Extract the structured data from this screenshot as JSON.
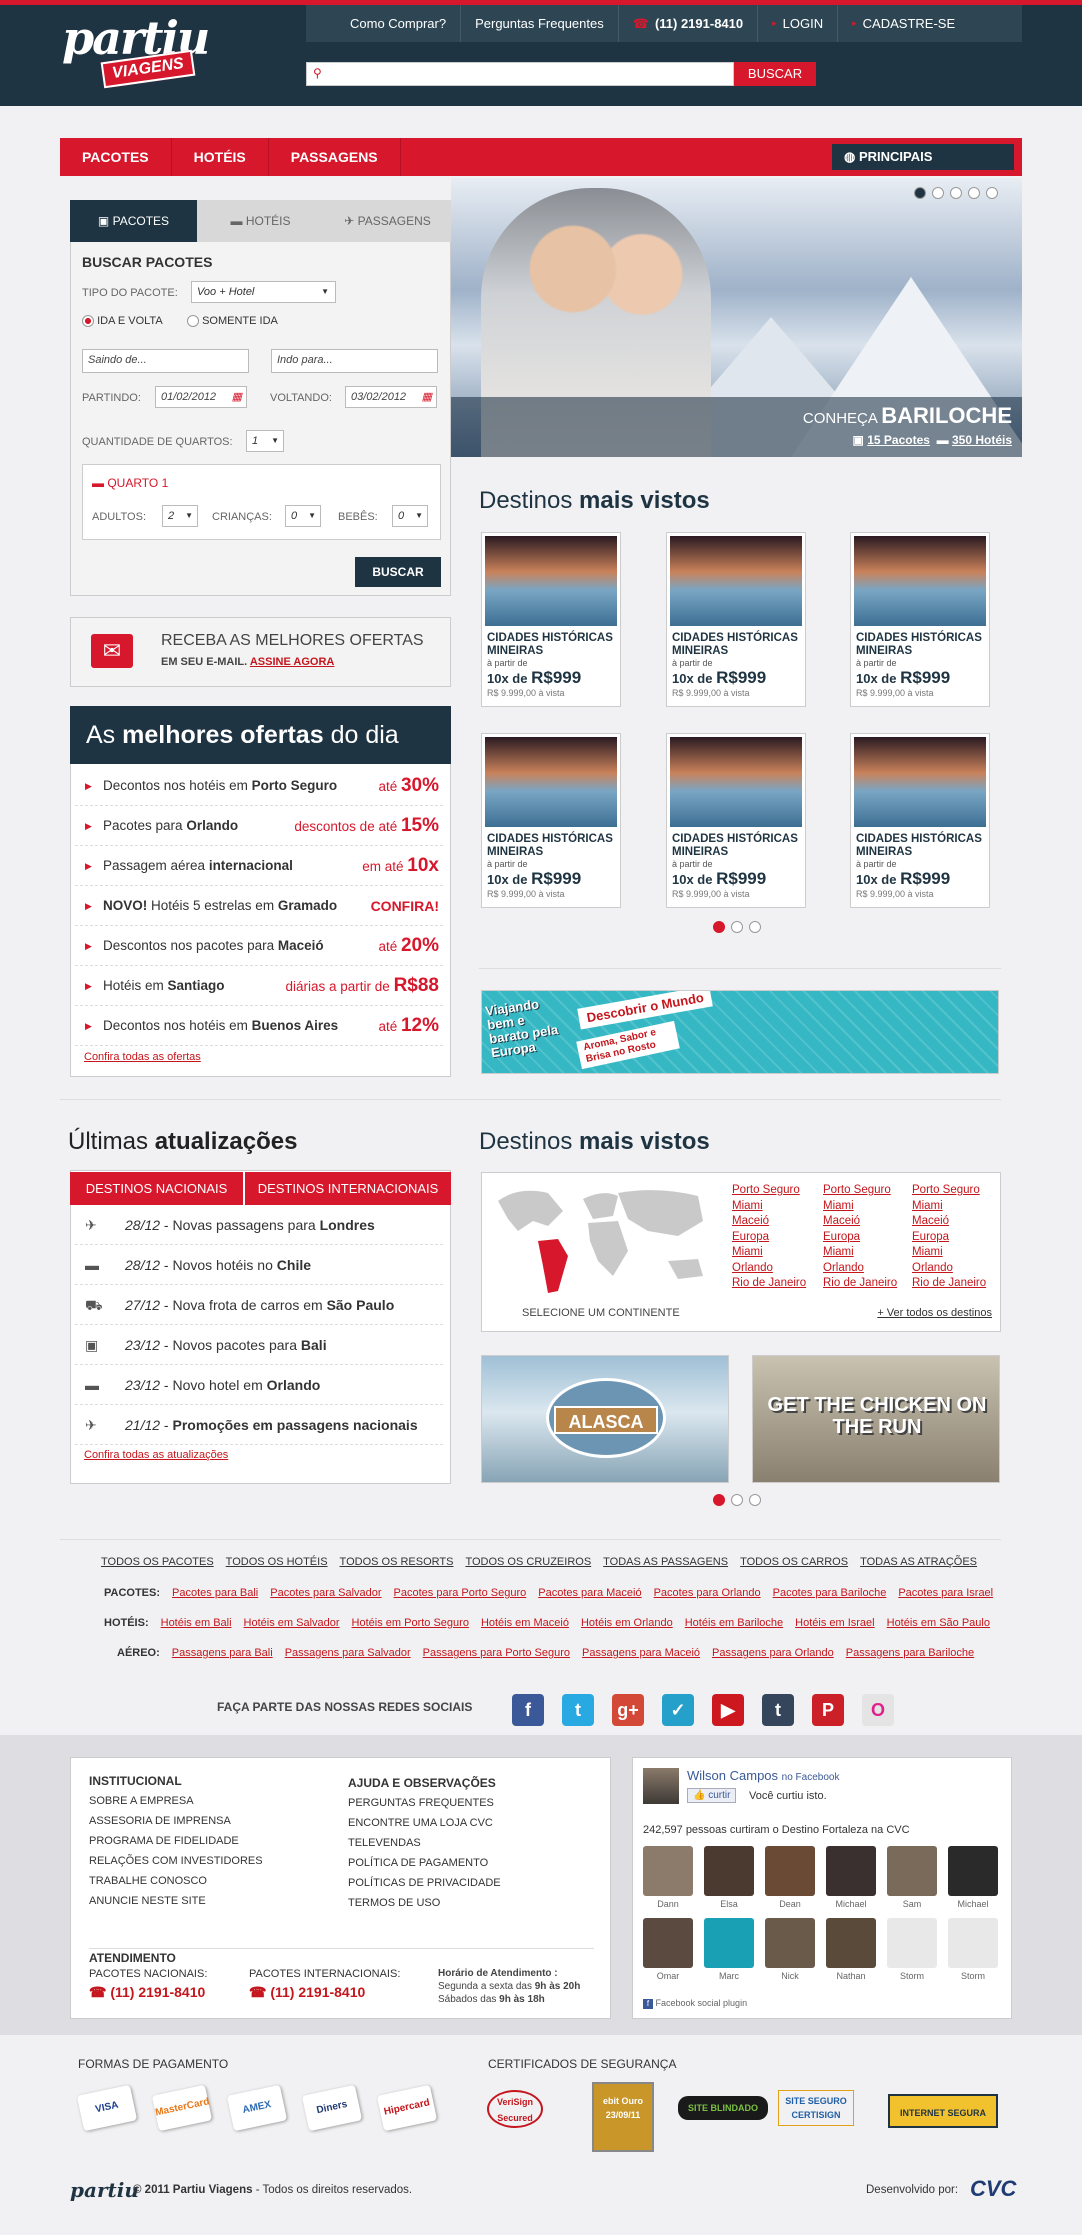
{
  "brand": {
    "logo_main": "partiu",
    "logo_sub": "VIAGENS"
  },
  "header": {
    "links": [
      "Como Comprar?",
      "Perguntas Frequentes"
    ],
    "phone": "(11) 2191-8410",
    "login": "LOGIN",
    "signup": "CADASTRE-SE",
    "search_placeholder": "",
    "search_button": "BUSCAR"
  },
  "nav": {
    "items": [
      "PACOTES",
      "HOTÉIS",
      "PASSAGENS"
    ],
    "dest_button": "PRINCIPAIS DESTINOS"
  },
  "hero": {
    "title_pre": "CONHEÇA",
    "title": "BARILOCHE",
    "pacotes": "15 Pacotes",
    "hoteis": "350 Hotéis",
    "slides": 5,
    "active_slide": 1
  },
  "search_panel": {
    "tabs": [
      "PACOTES",
      "HOTÉIS",
      "PASSAGENS"
    ],
    "title": "BUSCAR PACOTES",
    "tipo_label": "TIPO DO PACOTE:",
    "tipo_value": "Voo + Hotel",
    "radio1": "IDA E VOLTA",
    "radio2": "SOMENTE IDA",
    "origem_placeholder": "Saindo de...",
    "destino_placeholder": "Indo para...",
    "partindo_label": "PARTINDO:",
    "partindo_value": "01/02/2012",
    "voltando_label": "VOLTANDO:",
    "voltando_value": "03/02/2012",
    "quartos_label": "QUANTIDADE DE QUARTOS:",
    "quartos_value": "1",
    "quarto_title": "QUARTO 1",
    "adultos_label": "ADULTOS:",
    "adultos_value": "2",
    "criancas_label": "CRIANÇAS:",
    "criancas_value": "0",
    "bebes_label": "BEBÊS:",
    "bebes_value": "0",
    "button": "BUSCAR"
  },
  "newsletter": {
    "line1": "RECEBA AS MELHORES OFERTAS",
    "line2": "EM SEU E-MAIL.",
    "link": "ASSINE AGORA"
  },
  "offers": {
    "title_pre": "As",
    "title_bold": "melhores ofertas",
    "title_post": "do dia",
    "rows": [
      {
        "pre": "Decontos nos hotéis em ",
        "bold": "Porto Seguro",
        "post": "",
        "rpre": "até ",
        "rbig": "30%"
      },
      {
        "pre": "Pacotes para ",
        "bold": "Orlando",
        "post": "",
        "rpre": "descontos de até ",
        "rbig": "15%"
      },
      {
        "pre": "Passagem aérea ",
        "bold": "internacional",
        "post": "",
        "rpre": "em até ",
        "rbig": "10x"
      },
      {
        "pre": "",
        "bold": "NOVO!",
        "post": " Hotéis 5 estrelas em ",
        "bold2": "Gramado",
        "rpre": "",
        "rbig": "CONFIRA!"
      },
      {
        "pre": "Descontos nos pacotes para ",
        "bold": "Maceió",
        "post": "",
        "rpre": "até ",
        "rbig": "20%"
      },
      {
        "pre": "Hotéis em ",
        "bold": "Santiago",
        "post": "",
        "rpre": "diárias a partir de ",
        "rbig": "R$88"
      },
      {
        "pre": "Decontos nos hotéis em ",
        "bold": "Buenos Aires",
        "post": "",
        "rpre": "até ",
        "rbig": "12%"
      }
    ],
    "link": "Confira todas as ofertas"
  },
  "destinos": {
    "title_pre": "Destinos",
    "title_bold": "mais vistos",
    "card": {
      "title": "CIDADES HISTÓRICAS MINEIRAS",
      "from": "à partir de",
      "price_pre": "10x de",
      "price": "R$999",
      "cash": "R$ 9.999,00 à vista"
    }
  },
  "banner": {
    "text1": "Viajando bem e barato pela Europa",
    "text2": "Descobrir o Mundo",
    "text3": "Aroma, Sabor e Brisa no Rosto"
  },
  "updates": {
    "title_pre": "Últimas",
    "title_bold": "atualizações",
    "tabs": [
      "DESTINOS NACIONAIS",
      "DESTINOS INTERNACIONAIS"
    ],
    "rows": [
      {
        "icon": "plane-icon",
        "glyph": "✈",
        "date": "28/12",
        "text": " - Novas passagens para ",
        "bold": "Londres"
      },
      {
        "icon": "bed-icon",
        "glyph": "▬",
        "date": "28/12",
        "text": " - Novos hotéis no ",
        "bold": "Chile"
      },
      {
        "icon": "car-icon",
        "glyph": "⛟",
        "date": "27/12",
        "text": " - Nova frota de carros em ",
        "bold": "São Paulo"
      },
      {
        "icon": "suitcase-icon",
        "glyph": "▣",
        "date": "23/12",
        "text": " - Novos pacotes para ",
        "bold": "Bali"
      },
      {
        "icon": "bed-icon",
        "glyph": "▬",
        "date": "23/12",
        "text": " - Novo hotel em ",
        "bold": "Orlando"
      },
      {
        "icon": "plane-icon",
        "glyph": "✈",
        "date": "21/12",
        "text": " - ",
        "bold": "Promoções em passagens nacionais"
      }
    ],
    "link": "Confira todas as atualizações"
  },
  "map": {
    "title_pre": "Destinos",
    "title_bold": "mais vistos",
    "select": "SELECIONE UM CONTINENTE",
    "cities": [
      "Porto Seguro",
      "Miami",
      "Maceió",
      "Europa",
      "Miami",
      "Orlando",
      "Rio de Janeiro"
    ],
    "more": "+ Ver todos os destinos"
  },
  "promos": {
    "alasca": "ALASCA",
    "chicken": "GET THE CHICKEN ON THE RUN"
  },
  "links": {
    "top": [
      "TODOS OS PACOTES",
      "TODOS OS HOTÉIS",
      "TODOS OS RESORTS",
      "TODOS OS CRUZEIROS",
      "TODAS AS PASSAGENS",
      "TODOS OS CARROS",
      "TODAS AS ATRAÇÕES"
    ],
    "pacotes_label": "PACOTES:",
    "pacotes": [
      "Pacotes para Bali",
      "Pacotes para Salvador",
      "Pacotes para Porto Seguro",
      "Pacotes para Maceió",
      "Pacotes para Orlando",
      "Pacotes para Bariloche",
      "Pacotes para Israel"
    ],
    "hoteis_label": "HOTÉIS:",
    "hoteis": [
      "Hotéis em Bali",
      "Hotéis em Salvador",
      "Hotéis em Porto Seguro",
      "Hotéis em Maceió",
      "Hotéis em Orlando",
      "Hotéis em Bariloche",
      "Hotéis em Israel",
      "Hotéis em São Paulo"
    ],
    "aereo_label": "AÉREO:",
    "aereo": [
      "Passagens para Bali",
      "Passagens para Salvador",
      "Passagens para Porto Seguro",
      "Passagens para Maceió",
      "Passagens para Orlando",
      "Passagens para Bariloche"
    ]
  },
  "social": {
    "label": "FAÇA PARTE DAS NOSSAS REDES SOCIAIS",
    "icons": [
      {
        "name": "facebook-icon",
        "glyph": "f",
        "color": "#3b5998"
      },
      {
        "name": "twitter-icon",
        "glyph": "t",
        "color": "#29a9e1"
      },
      {
        "name": "googleplus-icon",
        "glyph": "g+",
        "color": "#d34836"
      },
      {
        "name": "foursquare-icon",
        "glyph": "✓",
        "color": "#25a0ca"
      },
      {
        "name": "youtube-icon",
        "glyph": "▶",
        "color": "#cc181e"
      },
      {
        "name": "tumblr-icon",
        "glyph": "t",
        "color": "#35465c"
      },
      {
        "name": "pinterest-icon",
        "glyph": "P",
        "color": "#cb2027"
      },
      {
        "name": "flickr-icon",
        "glyph": "O",
        "color": "#e4e4e4"
      }
    ]
  },
  "footer": {
    "inst_title": "INSTITUCIONAL",
    "inst": [
      "SOBRE A EMPRESA",
      "ASSESORIA DE IMPRENSA",
      "PROGRAMA DE FIDELIDADE",
      "RELAÇÕES COM INVESTIDORES",
      "TRABALHE CONOSCO",
      "ANUNCIE NESTE SITE"
    ],
    "ajuda_title": "AJUDA E OBSERVAÇÕES",
    "ajuda": [
      "PERGUNTAS FREQUENTES",
      "ENCONTRE UMA LOJA CVC",
      "TELEVENDAS",
      "POLÍTICA DE PAGAMENTO",
      "POLÍTICAS DE PRIVACIDADE",
      "TERMOS DE USO"
    ],
    "atend_title": "ATENDIMENTO",
    "nac_label": "PACOTES NACIONAIS:",
    "nac_phone": "(11) 2191-8410",
    "int_label": "PACOTES INTERNACIONAIS:",
    "int_phone": "(11) 2191-8410",
    "horario_title": "Horário de Atendimento :",
    "horario1_pre": "Segunda a sexta das ",
    "horario1_b": "9h às 20h",
    "horario2_pre": "Sábados das ",
    "horario2_b": "9h às 18h"
  },
  "facebook": {
    "user": "Wilson Campos",
    "on": "no Facebook",
    "like_btn": "curtir",
    "liked": "Você curtiu isto.",
    "count_text": "242,597 pessoas curtiram o Destino Fortaleza na CVC",
    "fans": [
      "Dann",
      "Elsa",
      "Dean",
      "Michael",
      "Sam",
      "Michael",
      "Omar",
      "Marc",
      "Nick",
      "Nathan",
      "Storm",
      "Storm"
    ],
    "plugin": "Facebook social plugin"
  },
  "payment": {
    "title": "FORMAS DE PAGAMENTO",
    "cards": [
      {
        "name": "visa-icon",
        "label": "VISA",
        "color": "#1a3d8f"
      },
      {
        "name": "mastercard-icon",
        "label": "MasterCard",
        "color": "#e8791a"
      },
      {
        "name": "amex-icon",
        "label": "AMEX",
        "color": "#2b6cb0"
      },
      {
        "name": "diners-icon",
        "label": "Diners",
        "color": "#1f3b73"
      },
      {
        "name": "hipercard-icon",
        "label": "Hipercard",
        "color": "#c4161c"
      }
    ]
  },
  "certs": {
    "title": "CERTIFICADOS DE SEGURANÇA",
    "items": [
      "VeriSign Secured",
      "ebit Ouro 23/09/11",
      "SITE BLINDADO",
      "SITE SEGURO CERTISIGN",
      "INTERNET SEGURA"
    ]
  },
  "copyright": {
    "text": "© 2011 Partiu Viagens",
    "rest": " - Todos os direitos reservados.",
    "dev": "Desenvolvido por:",
    "dev_logo": "CVC"
  }
}
